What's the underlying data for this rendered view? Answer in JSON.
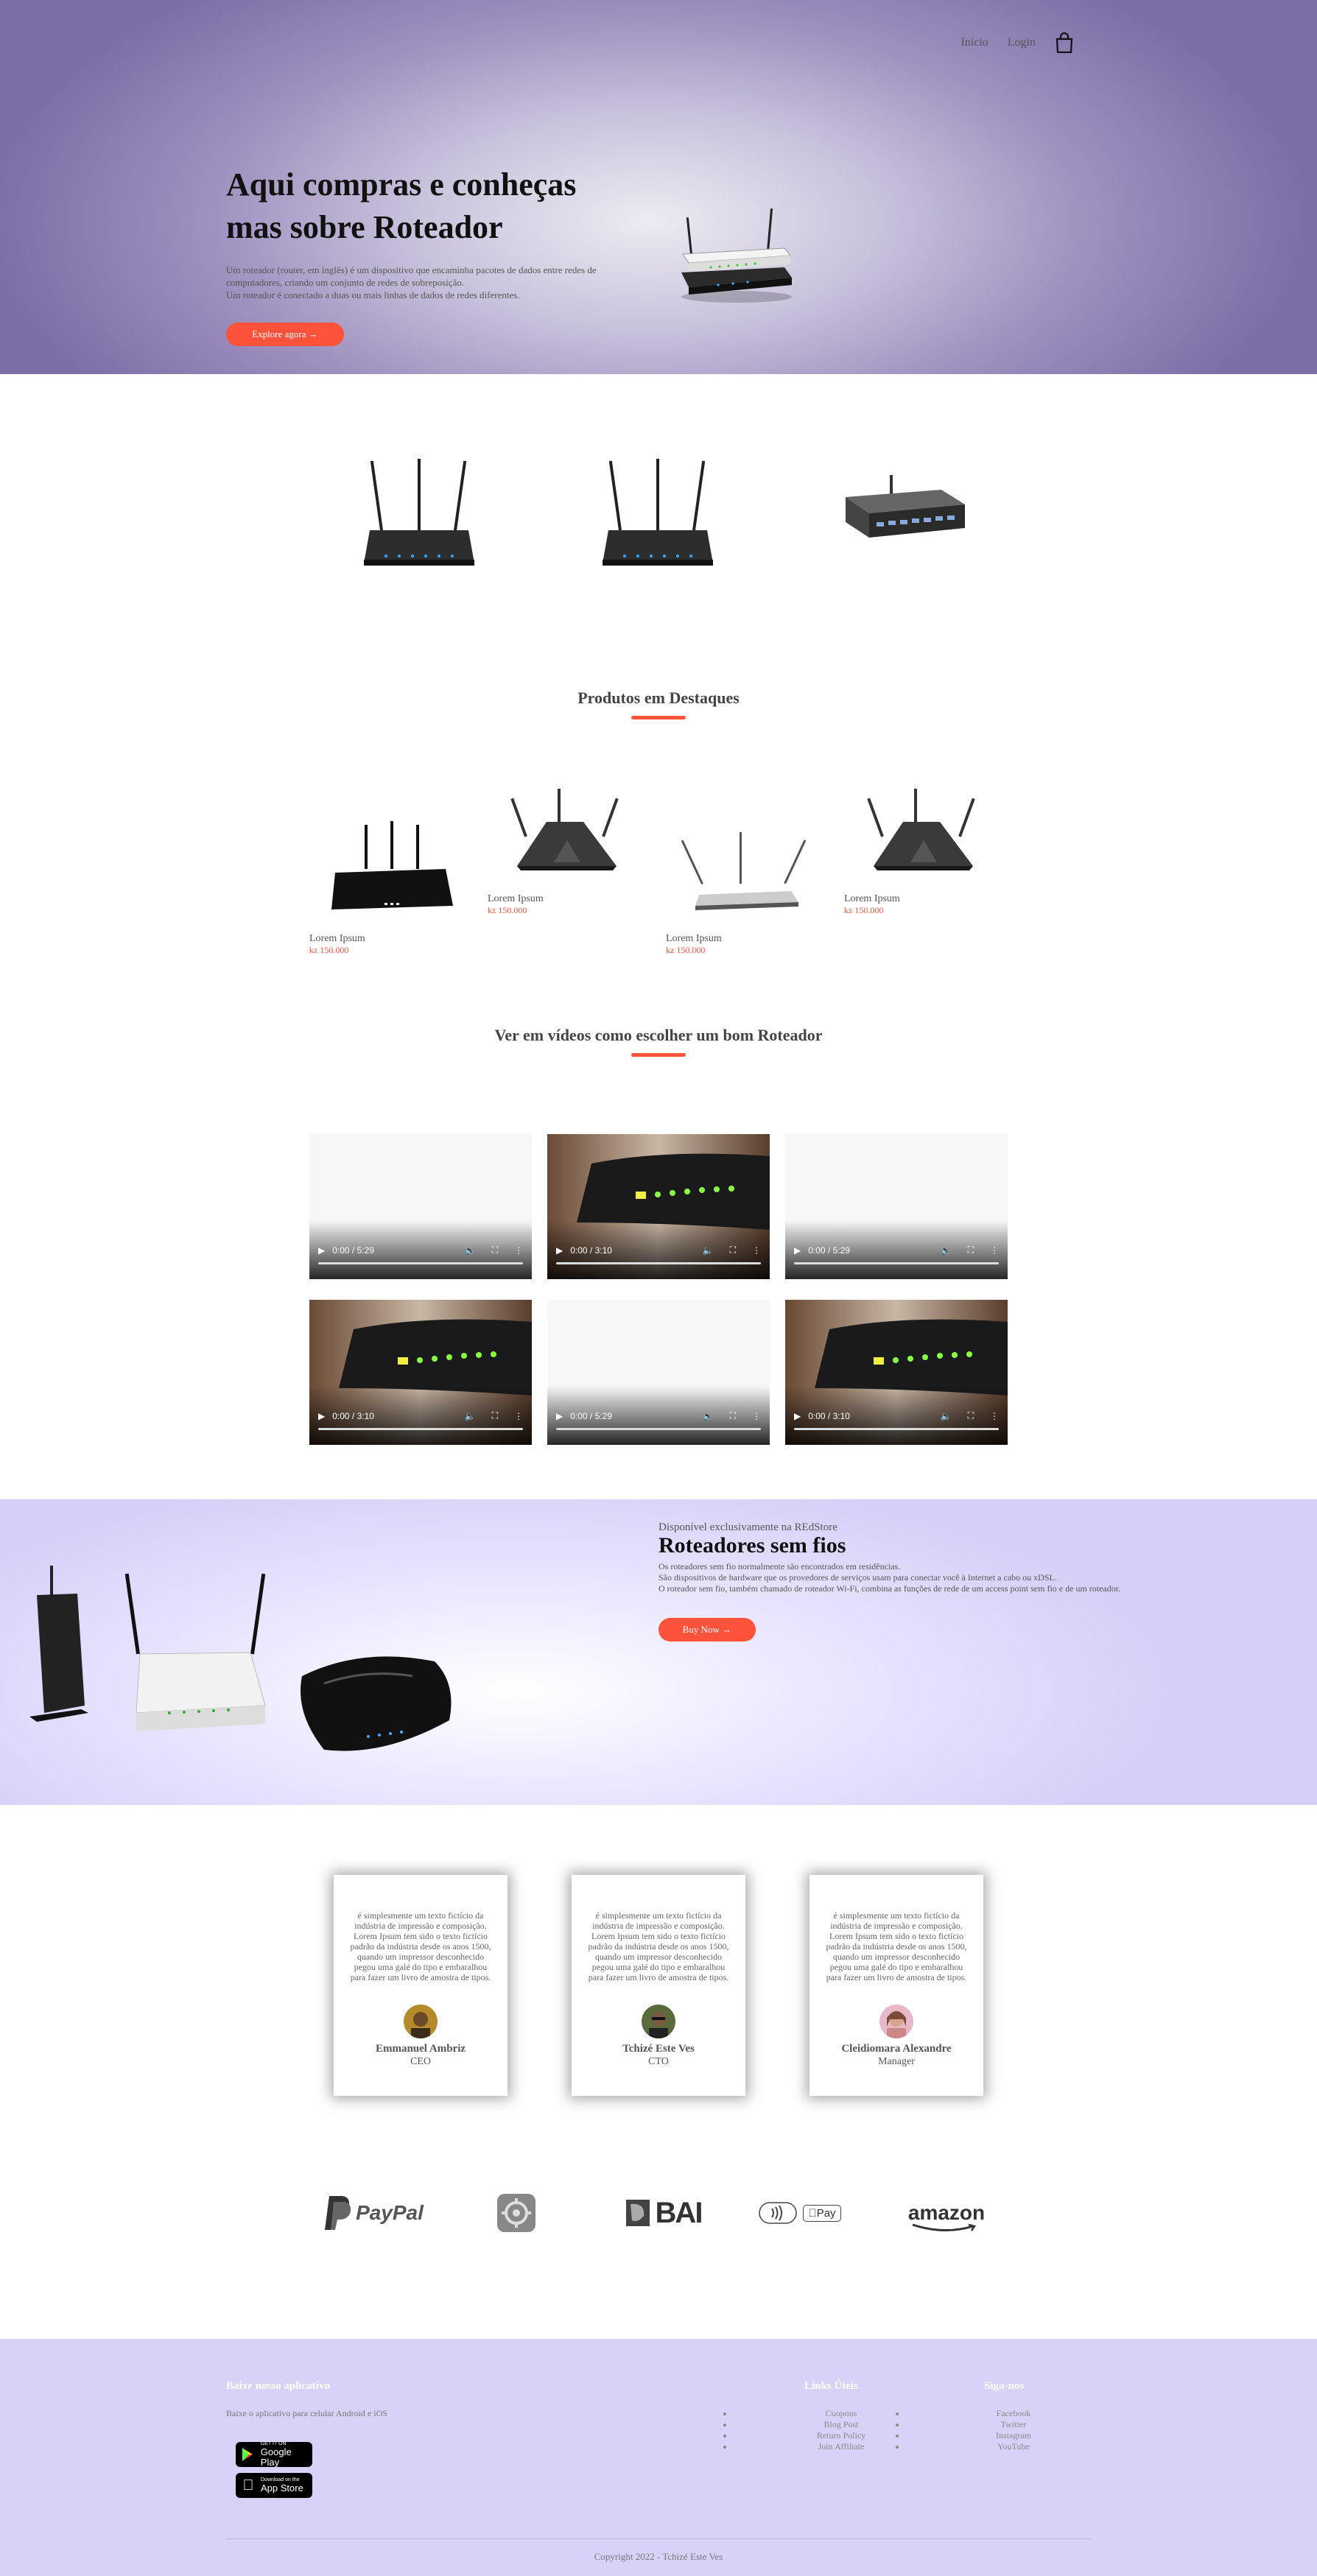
{
  "nav": {
    "items": [
      "Início",
      "Login"
    ]
  },
  "hero": {
    "title_line1": "Aqui compras e conheças",
    "title_line2": "mas sobre Roteador",
    "text_line1": "Um roteador (router, em inglês) é um dispositivo que encaminha pacotes de dados entre redes de",
    "text_line2": "computadores, criando um conjunto de redes de sobreposição.",
    "text_line3": "Um roteador é conectado a duas ou mais linhas de dados de redes diferentes.",
    "button": "Explore agora →"
  },
  "featured": {
    "title": "Produtos em Destaques",
    "products": [
      {
        "name": "Lorem Ipsum",
        "price": "kz 150.000"
      },
      {
        "name": "Lorem Ipsum",
        "price": "kz 150.000"
      },
      {
        "name": "Lorem Ipsum",
        "price": "kz 150.000"
      },
      {
        "name": "Lorem Ipsum",
        "price": "kz 150.000"
      }
    ]
  },
  "videos": {
    "title": "Ver em vídeos como escolher um bom Roteador",
    "items": [
      {
        "time": "0:00 / 5:29",
        "thumb": "blank"
      },
      {
        "time": "0:00 / 3:10",
        "thumb": "router"
      },
      {
        "time": "0:00 / 5:29",
        "thumb": "blank"
      },
      {
        "time": "0:00 / 3:10",
        "thumb": "router"
      },
      {
        "time": "0:00 / 5:29",
        "thumb": "blank"
      },
      {
        "time": "0:00 / 3:10",
        "thumb": "router"
      }
    ]
  },
  "offer": {
    "small": "Disponível exclusivamente na REdStore",
    "title": "Roteadores sem fios",
    "text_line1": "Os roteadores sem fio normalmente são encontrados em residências.",
    "text_line2": "São dispositivos de hardware que os provedores de serviços usam para conectar você à Internet a cabo ou xDSL.",
    "text_line3": "O roteador sem fio, também chamado de roteador Wi-Fi, combina as funções de rede de um access point sem fio e de um roteador.",
    "button": "Buy Now →"
  },
  "testimonials": [
    {
      "text": "é simplesmente um texto fictício da indústria de impressão e composição. Lorem Ipsum tem sido o texto fictício padrão da indústria desde os anos 1500, quando um impressor desconhecido pegou uma galé do tipo e embaralhou para fazer um livro de amostra de tipos.",
      "name": "Emmanuel Ambriz",
      "role": "CEO"
    },
    {
      "text": "é simplesmente um texto fictício da indústria de impressão e composição. Lorem Ipsum tem sido o texto fictício padrão da indústria desde os anos 1500, quando um impressor desconhecido pegou uma galé do tipo e embaralhou para fazer um livro de amostra de tipos.",
      "name": "Tchizé Este Ves",
      "role": "CTO"
    },
    {
      "text": "é simplesmente um texto fictício da indústria de impressão e composição. Lorem Ipsum tem sido o texto fictício padrão da indústria desde os anos 1500, quando um impressor desconhecido pegou uma galé do tipo e embaralhou para fazer um livro de amostra de tipos.",
      "name": "Cleidiomara Alexandre",
      "role": "Manager"
    }
  ],
  "brands": {
    "paypal": "PayPal",
    "bai": "BAI",
    "apple_pay": "Pay",
    "amazon": "amazon"
  },
  "footer": {
    "app_title": "Baixe nosso aplicativo",
    "app_text": "Baixe o aplicativo para celular Android e iOS",
    "google_small": "GET IT ON",
    "google_big": "Google Play",
    "apple_small": "Download on the",
    "apple_big": "App Store",
    "links_title": "Links Úteis",
    "links": [
      "Cuopons",
      "Blog Post",
      "Return Policy",
      "Join Affiliate"
    ],
    "follow_title": "Siga-nos",
    "follow": [
      "Facebook",
      "Twitter",
      "Instagram",
      "YouTube"
    ],
    "copyright": "Copyright 2022 - Tchizé Este Ves"
  },
  "colors": {
    "accent": "#ff523b",
    "hero_purple": "#7c6da6",
    "footer_bg": "#d8d2f8"
  }
}
